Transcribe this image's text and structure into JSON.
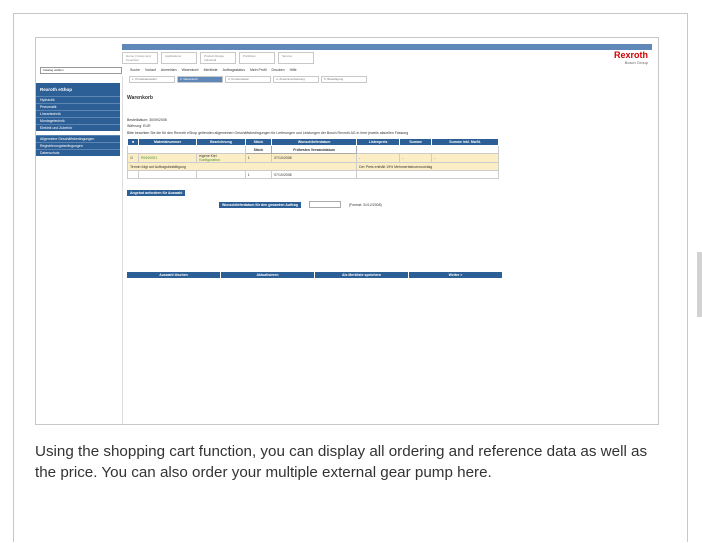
{
  "app": {
    "topbar_text": "Englisch | Ihr Ansprechpartner | Kontakt | Impressum",
    "menu": [
      "Home | Group and Countries",
      "Applications",
      "Product Range Industrial",
      "Portfolios",
      "Service"
    ],
    "logo_primary": "Rexroth",
    "logo_secondary": "Bosch Group",
    "catalog_select": "Katalog wählen",
    "toolbar": [
      "Suche",
      "Vorlauf",
      "Anmelden",
      "Warenkorb",
      "Merkliste",
      "Auftragsstatus",
      "Mein Profil",
      "Drucken",
      "Hilfe"
    ]
  },
  "sidebar": {
    "shop_title": "Rexroth eShop",
    "items": [
      "Hydraulik",
      "Pneumatik",
      "Lineartechnik",
      "Montagetechnik",
      "Elektrik und Zubehör"
    ],
    "items2": [
      "Allgemeine Geschäftsbedingungen",
      "Registrierungsbedingungen",
      "Datenschutz"
    ]
  },
  "steps": [
    "1. Produktauswahl",
    "2. Warenkorb",
    "3. Kundendaten",
    "4. Zusammenfassung",
    "5. Bestätigung"
  ],
  "page": {
    "title": "Warenkorb",
    "date_label": "Bestelldatum:",
    "date_value": "30/09/2008",
    "currency_label": "Währung:",
    "currency_value": "EUR",
    "notice": "Bitte beachten Sie die für den Rexroth eShop geltenden allgemeinen Geschäftsbedingungen für Lieferungen und Leistungen der Bosch Rexroth AG in ihrer jeweils aktuellen Fassung"
  },
  "cart": {
    "headers": [
      "Materialnummer",
      "Bezeichnung",
      "Stück",
      "Wunschlieferdatum",
      "Listenpreis",
      "Summe",
      "Summe inkl. MwSt."
    ],
    "subheaders": [
      "Stück",
      "Frühestes Versanddatum"
    ],
    "item": {
      "material": "R9190001",
      "desc1": "eigene Kiel",
      "desc2": "Konfiguration",
      "qty": "1",
      "date": "07/10/2008",
      "price": "-",
      "sum": "-",
      "sum_tax": "-"
    },
    "note": "Termin folgt auf Auftragsbestätigung",
    "price_note": "Der Preis enthält 19% Mehrwertsteuerzuschlag",
    "qty2": "1",
    "date2": "07/10/2008",
    "offer_button": "Angebot anfordern für Auswahl",
    "wish_date_label": "Wunschlieferdatum für den gesamten Auftrag",
    "format_hint": "(Format: 31/12/2008)"
  },
  "bottom_buttons": [
    "Auswahl löschen",
    "Aktualisieren",
    "Als Merkliste speichern",
    "Weiter >"
  ],
  "caption": "Using the shopping cart function, you can display all ordering and reference data as well as the price. You can also order your multiple external gear pump here."
}
